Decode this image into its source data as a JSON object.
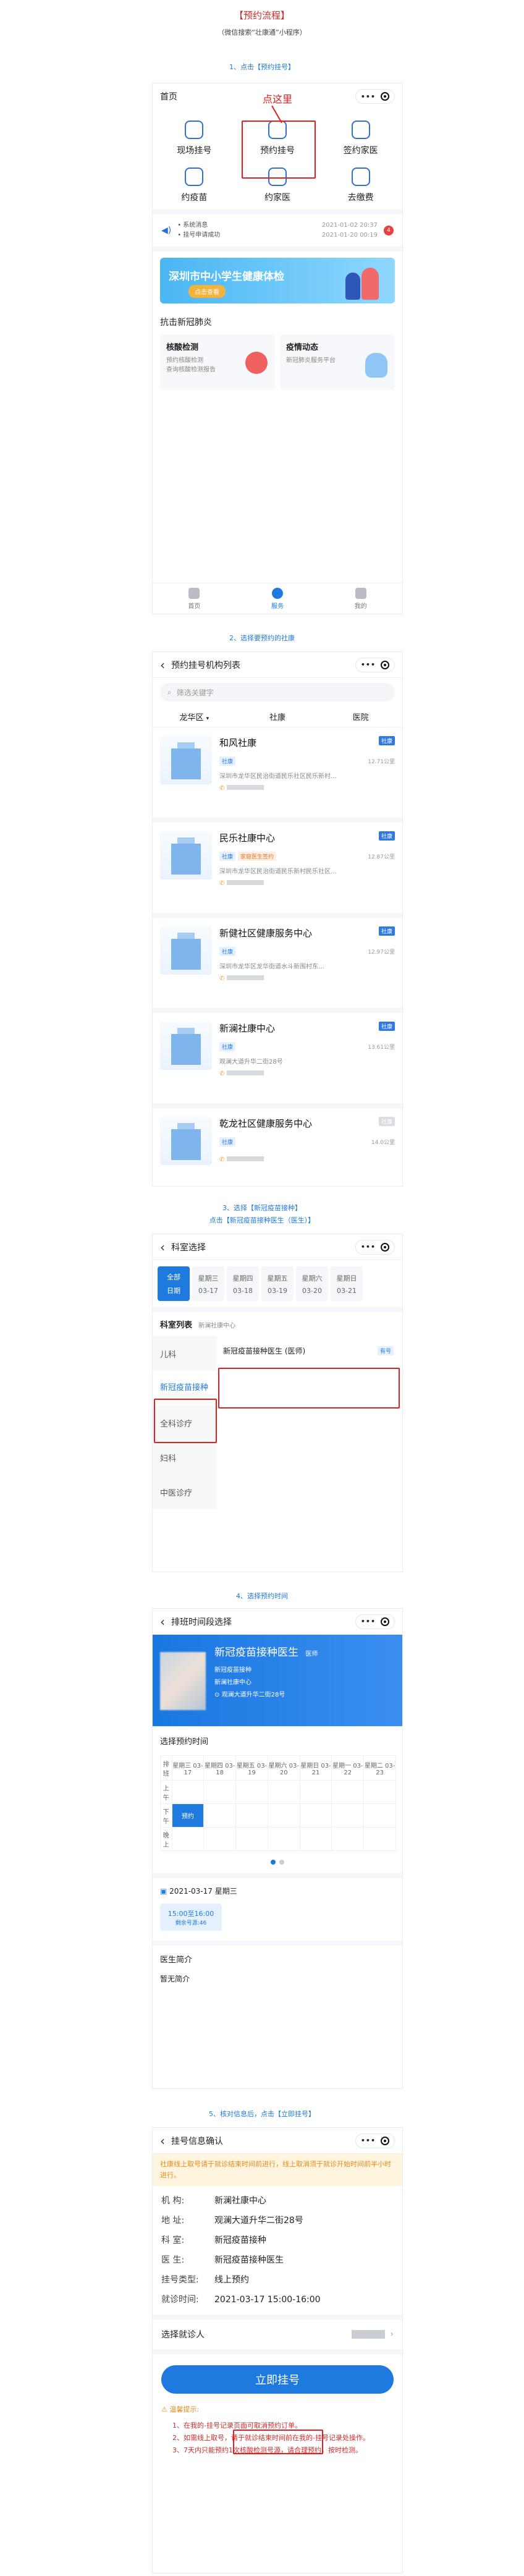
{
  "main_title": "【预约流程】",
  "subtitle": "（微信搜索“壮康通”小程序）",
  "steps": {
    "s1": "1、点击【预约挂号】",
    "s2": "2、选择要预约的社康",
    "s3a": "3、选择【新冠疫苗接种】",
    "s3b": "点击【新冠疫苗接种医生（医生）】",
    "s4": "4、选择预约时间",
    "s5": "5、核对信息后，点击【立即挂号】"
  },
  "screen1": {
    "tab": "首页",
    "annotation": "点这里",
    "grid": [
      "现场挂号",
      "预约挂号",
      "签约家医",
      "约疫苗",
      "约家医",
      "去缴费"
    ],
    "notice1_label": "• 系统消息",
    "notice1_time": "2021-01-02 20:37",
    "notice2_label": "• 挂号申请成功",
    "notice2_time": "2021-01-20 00:19",
    "notice_badge": "4",
    "banner_title": "深圳市中小学生健康体检",
    "banner_btn": "点击查看",
    "section": "抗击新冠肺炎",
    "card1_title": "核酸检测",
    "card1_desc1": "预约核酸检测",
    "card1_desc2": "查询核酸检测报告",
    "card2_title": "疫情动态",
    "card2_desc": "新冠肺炎服务平台",
    "tabs": [
      "首页",
      "服务",
      "我的"
    ]
  },
  "screen2": {
    "title": "预约挂号机构列表",
    "search_placeholder": "筛选关键字",
    "filters": [
      "龙华区",
      "社康",
      "医院"
    ],
    "list": [
      {
        "name": "和风社康",
        "tags": [
          "社康"
        ],
        "addr": "深圳市龙华区民治街道民乐社区民乐新村…",
        "dist": "12.71公里",
        "corner": "社康"
      },
      {
        "name": "民乐社康中心",
        "tags": [
          "社康",
          "家庭医生签约"
        ],
        "addr": "深圳市龙华区民治街道民乐新村民乐社区…",
        "dist": "12.87公里",
        "corner": "社康"
      },
      {
        "name": "新健社区健康服务中心",
        "tags": [
          "社康"
        ],
        "addr": "深圳市龙华区龙华街道水斗新围村东…",
        "dist": "12.97公里",
        "corner": "社康"
      },
      {
        "name": "新澜社康中心",
        "tags": [
          "社康"
        ],
        "addr": "观澜大道升华二街28号",
        "dist": "13.61公里",
        "corner": "社康"
      },
      {
        "name": "乾龙社区健康服务中心",
        "tags": [
          "社康"
        ],
        "addr": "",
        "dist": "14.0公里",
        "corner": "社康"
      }
    ]
  },
  "screen3": {
    "title": "科室选择",
    "dates": [
      {
        "top": "全部",
        "bottom": "日期"
      },
      {
        "top": "星期三",
        "bottom": "03-17"
      },
      {
        "top": "星期四",
        "bottom": "03-18"
      },
      {
        "top": "星期五",
        "bottom": "03-19"
      },
      {
        "top": "星期六",
        "bottom": "03-20"
      },
      {
        "top": "星期日",
        "bottom": "03-21"
      }
    ],
    "list_label": "科室列表",
    "list_org": "新澜社康中心",
    "depts": [
      "儿科",
      "新冠疫苗接种",
      "全科诊疗",
      "妇科",
      "中医诊疗"
    ],
    "doctor": "新冠疫苗接种医生 (医师)",
    "doctor_tag": "有号"
  },
  "screen4": {
    "title": "排班时间段选择",
    "doc_name": "新冠疫苗接种医生",
    "doc_level": "医师",
    "doc_dept": "新冠疫苗接种",
    "doc_org": "新澜社康中心",
    "doc_addr": "观澜大道升华二街28号",
    "section": "选择预约时间",
    "header": [
      "排班",
      "星期三 03-17",
      "星期四 03-18",
      "星期五 03-19",
      "星期六 03-20",
      "星期日 03-21",
      "星期一 03-22",
      "星期二 03-23"
    ],
    "rows": [
      "上午",
      "下午",
      "晚上"
    ],
    "slot_label": "预约",
    "date_line": "2021-03-17 星期三",
    "time_slot": "15:00至16:00",
    "remain": "剩余号源:46",
    "intro_title": "医生简介",
    "intro_text": "暂无简介"
  },
  "screen5": {
    "title": "挂号信息确认",
    "warning": "社康线上取号请于就诊结束时间前进行，线上取消须于就诊开始时间前半小时进行。",
    "fields": [
      {
        "k": "机      构:",
        "v": "新澜社康中心"
      },
      {
        "k": "地      址:",
        "v": "观澜大道升华二街28号"
      },
      {
        "k": "科      室:",
        "v": "新冠疫苗接种"
      },
      {
        "k": "医      生:",
        "v": "新冠疫苗接种医生"
      },
      {
        "k": "挂号类型:",
        "v": "线上预约"
      },
      {
        "k": "就诊时间:",
        "v": "2021-03-17 15:00-16:00"
      }
    ],
    "patient_label": "选择就诊人",
    "button": "立即挂号",
    "tips_title": "温馨提示:",
    "tips": [
      "1、在我的-挂号记录页面可取消预约订单。",
      "2、如需线上取号，请于就诊结束时间前在我的-挂号记录处操作。",
      "3、7天内只能预约1次核酸检测号源，请合理预约，按时检测。"
    ]
  },
  "colors": {
    "accent": "#1f7ae0",
    "red": "#d32a2a"
  }
}
